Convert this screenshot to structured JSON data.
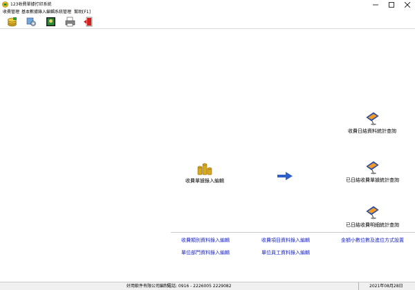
{
  "window": {
    "title": "123收費單據打印系統"
  },
  "menu": [
    "收費管理",
    "基本數據錄入編輯",
    "系統管理",
    "幫助[F1]"
  ],
  "toolbar": {
    "icons": [
      "money-icon",
      "settings-icon",
      "photo-icon",
      "print-icon",
      "exit-icon"
    ]
  },
  "main": {
    "entry_label": "收費單據錄入編輯",
    "query_1": "收費日結資料統計查詢",
    "query_2": "已日結收費單據統計查詢",
    "query_3": "已日結收費明細統計查詢",
    "links": {
      "fee_category": "收費類別資料錄入編輯",
      "fee_item": "收費項目資料錄入編輯",
      "decimal_settings": "金額小數位數及進位方式設置",
      "department": "單位部門資料錄入編輯",
      "staff": "單位員工資料錄入編輯"
    }
  },
  "status": {
    "company": "好用軟件有限公司編制",
    "phone": "電話: 0916 - 2226005   2229082",
    "date": "2021年08月28日"
  },
  "colors": {
    "link": "#1a25c8",
    "arrow": "#2f5fc8"
  }
}
